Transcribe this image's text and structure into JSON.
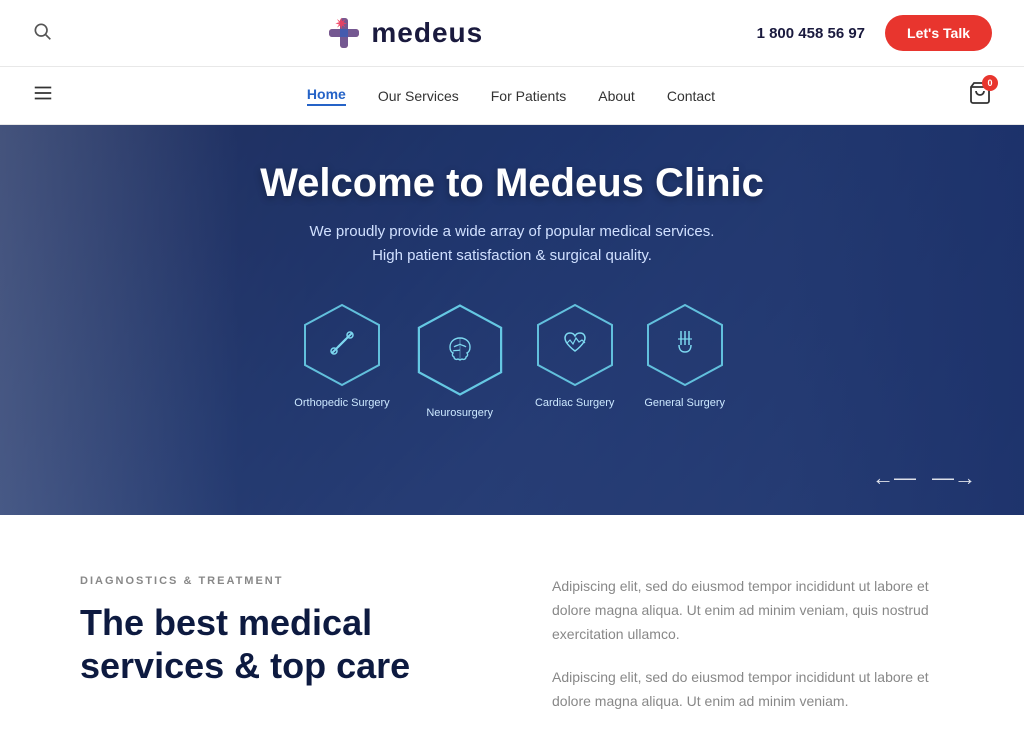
{
  "topbar": {
    "phone": "1 800 458 56 97",
    "lets_talk": "Let's Talk"
  },
  "logo": {
    "text": "medeus"
  },
  "nav": {
    "items": [
      {
        "label": "Home",
        "active": true
      },
      {
        "label": "Our Services",
        "active": false
      },
      {
        "label": "For Patients",
        "active": false
      },
      {
        "label": "About",
        "active": false
      },
      {
        "label": "Contact",
        "active": false
      }
    ]
  },
  "cart": {
    "badge": "0"
  },
  "hero": {
    "title": "Welcome to Medeus Clinic",
    "subtitle_line1": "We proudly provide a wide array of popular medical services.",
    "subtitle_line2": "High patient satisfaction & surgical quality.",
    "services": [
      {
        "label": "Orthopedic Surgery",
        "icon": "bone"
      },
      {
        "label": "Neurosurgery",
        "icon": "brain"
      },
      {
        "label": "Cardiac Surgery",
        "icon": "heart"
      },
      {
        "label": "General Surgery",
        "icon": "scissors"
      }
    ]
  },
  "content": {
    "tag": "Diagnostics & Treatment",
    "title_line1": "The best medical",
    "title_line2": "services & top care",
    "para1": "Adipiscing elit, sed do eiusmod tempor incididunt ut labore et dolore magna aliqua. Ut enim ad minim veniam, quis nostrud exercitation ullamco.",
    "para2": "Adipiscing elit, sed do eiusmod tempor incididunt ut labore et dolore magna aliqua. Ut enim ad minim veniam."
  }
}
